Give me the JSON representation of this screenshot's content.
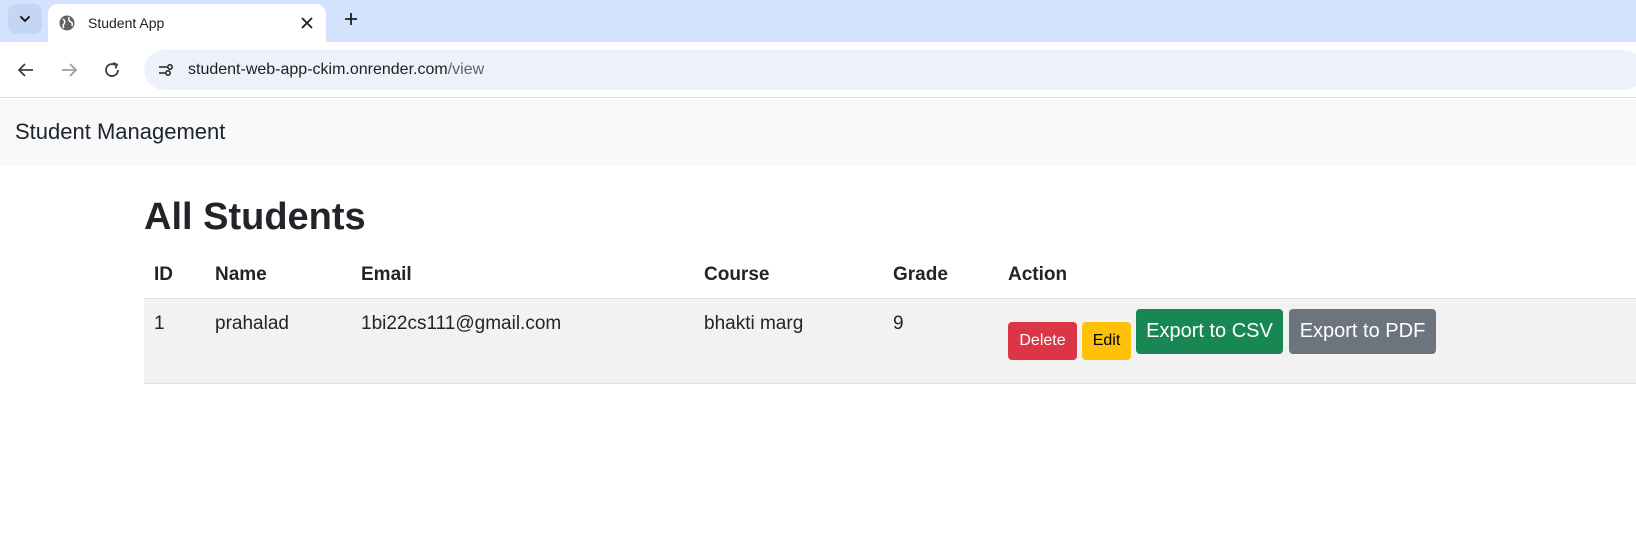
{
  "browser": {
    "tab_title": "Student App",
    "url_host": "student-web-app-ckim.onrender.com",
    "url_path": "/view"
  },
  "page": {
    "brand": "Student Management",
    "heading": "All Students"
  },
  "table": {
    "headers": [
      "ID",
      "Name",
      "Email",
      "Course",
      "Grade",
      "Action"
    ],
    "rows": [
      {
        "id": "1",
        "name": "prahalad",
        "email": "1bi22cs111@gmail.com",
        "course": "bhakti marg",
        "grade": "9"
      }
    ]
  },
  "actions": {
    "delete": "Delete",
    "edit": "Edit",
    "export_csv": "Export to CSV",
    "export_pdf": "Export to PDF"
  },
  "colors": {
    "delete": "#dc3545",
    "edit": "#ffc107",
    "export_csv": "#198754",
    "export_pdf": "#6c757d"
  },
  "icons": [
    "chevron-down-icon",
    "globe-icon",
    "close-icon",
    "plus-icon",
    "back-arrow-icon",
    "forward-arrow-icon",
    "reload-icon",
    "site-info-icon"
  ]
}
